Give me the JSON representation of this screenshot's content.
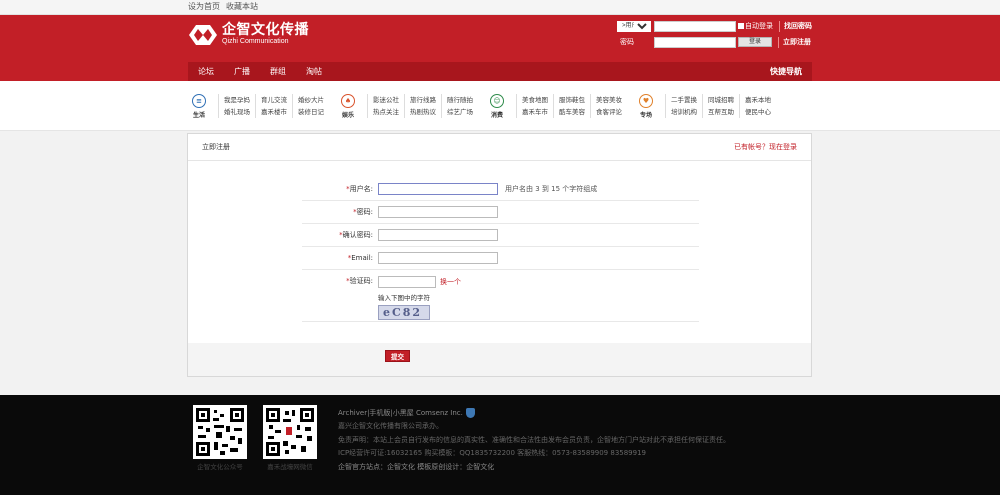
{
  "topbar": {
    "set_home": "设为首页",
    "bookmark": "收藏本站"
  },
  "logo": {
    "title": "企智文化传播",
    "subtitle": "Qizhi Communication"
  },
  "login": {
    "type_option": ">用户",
    "password_label": "密码",
    "remember": "自动登录",
    "login_button": "登录",
    "find_password": "找回密码",
    "register_now": "立即注册"
  },
  "nav": {
    "items": [
      "论坛",
      "广播",
      "群组",
      "淘帖"
    ],
    "quick": "快捷导航"
  },
  "categories": [
    {
      "icon_label": "生活",
      "color": "#2f6fb5",
      "cols": [
        [
          "我是孕妈",
          "婚礼现场"
        ],
        [
          "育儿交流",
          "嘉禾楼市"
        ],
        [
          "婚纱大片",
          "装修日记"
        ]
      ]
    },
    {
      "icon_label": "娱乐",
      "color": "#d9532c",
      "cols": [
        [
          "影迷公社",
          "热点关注"
        ],
        [
          "旅行线路",
          "热剧热议"
        ],
        [
          "随行随拍",
          "综艺广场"
        ]
      ]
    },
    {
      "icon_label": "消费",
      "color": "#2e8b4a",
      "cols": [
        [
          "美食地图",
          "嘉禾车市"
        ],
        [
          "服饰鞋包",
          "酷车美容"
        ],
        [
          "美容美妆",
          "食客评论"
        ]
      ]
    },
    {
      "icon_label": "专场",
      "color": "#e0802a",
      "cols": [
        [
          "二手置换",
          "培训机构"
        ],
        [
          "同城招聘",
          "互帮互助"
        ],
        [
          "嘉禾本地",
          "便民中心"
        ]
      ]
    }
  ],
  "panel": {
    "title": "立即注册",
    "has_account": "已有帐号？现在登录",
    "fields": {
      "username": "用户名:",
      "username_tip": "用户名由 3 到 15 个字符组成",
      "password": "密码:",
      "confirm": "确认密码:",
      "email": "Email:",
      "captcha": "验证码:",
      "swap": "换一个",
      "captcha_hint": "输入下图中的字符",
      "captcha_text": "eC82"
    },
    "submit": "提交"
  },
  "footer": {
    "qr1_label": "企智文化公众号",
    "qr2_label": "嘉禾战壕网微信",
    "line1": "Archiver|手机版|小黑屋 Comsenz Inc.",
    "line2": "嘉兴企智文化传播有限公司承办。",
    "line3": "免责声明：本站上会员自行发布的信息的真实性、准确性和合法性由发布会员负责，企智地方门户站对此不承担任何保证责任。",
    "line4": "ICP经营许可证:16032165 购买模板：QQ1835732200 客服热线：0573-83589909 83589919",
    "line5": "企智官方站点：企智文化 模板原创设计：企智文化"
  }
}
